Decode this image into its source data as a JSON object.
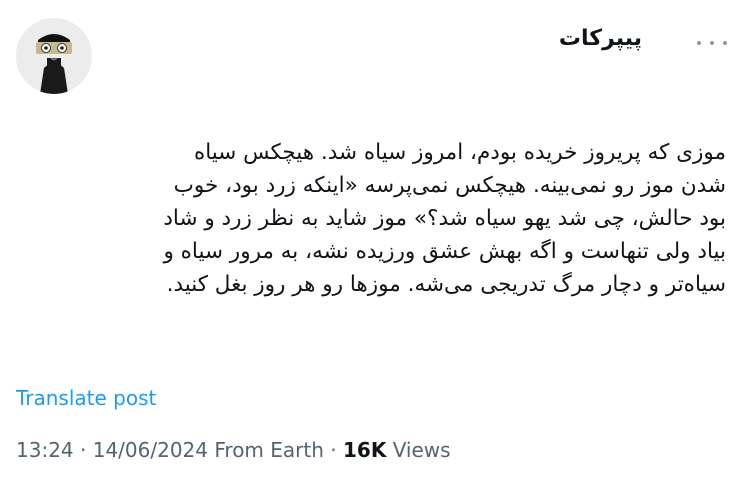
{
  "post": {
    "author_name": "پیپرکات",
    "text": "موزی که پریروز خریده بودم، امروز سیاه شد. هیچکس سیاه\nشدن موز رو نمی‌بینه. هیچکس نمی‌پرسه «اینکه زرد بود، خوب\nبود حالش، چی شد یهو سیاه شد؟» موز شاید به نظر زرد و شاد\nبیاد ولی تنهاست و اگه بهش عشق ورزیده نشه، به مرور سیاه و\nسیاه‌تر و دچار مرگ تدریجی می‌شه. موزها رو هر روز بغل کنید.",
    "translate_label": "Translate post",
    "time": "13:24",
    "separator": "·",
    "date": "14/06/2024",
    "source": "From Earth",
    "views_count": "16K",
    "views_label": "Views"
  },
  "icons": {
    "more": "more-horizontal-icon"
  },
  "colors": {
    "link": "#1d9bf0",
    "muted": "#536471",
    "text": "#0f1419"
  }
}
